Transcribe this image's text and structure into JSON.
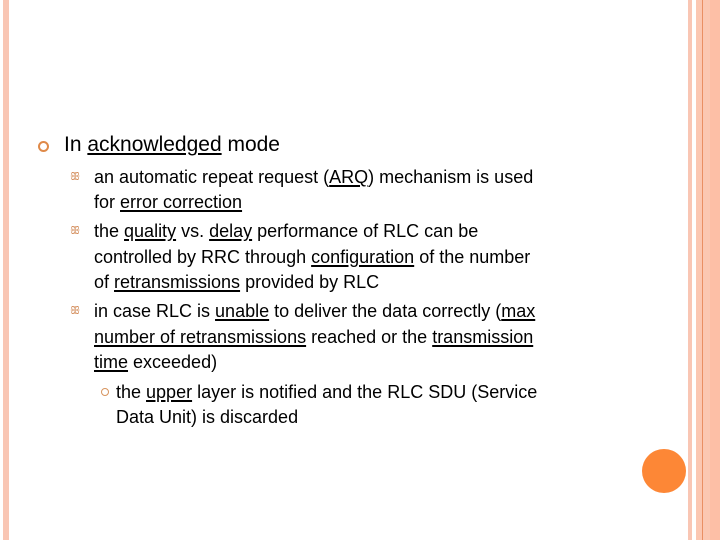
{
  "slide": {
    "level1": {
      "bullet_icon": "circle-bullet",
      "segments": [
        {
          "text": "In ",
          "u": false
        },
        {
          "text": "acknowledged",
          "u": true
        },
        {
          "text": " mode",
          "u": false
        }
      ]
    },
    "level2_bullet_icon": "swirl-bullet",
    "level3_bullet_icon": "small-circle-bullet",
    "lines": [
      {
        "segments": [
          {
            "text": "an automatic repeat request (",
            "u": false
          },
          {
            "text": "ARQ",
            "u": true
          },
          {
            "text": ") mechanism is used",
            "u": false
          }
        ]
      },
      {
        "segments": [
          {
            "text": "for ",
            "u": false
          },
          {
            "text": "error correction",
            "u": true
          }
        ]
      },
      {
        "segments": [
          {
            "text": "the ",
            "u": false
          },
          {
            "text": "quality",
            "u": true
          },
          {
            "text": " vs. ",
            "u": false
          },
          {
            "text": "delay",
            "u": true
          },
          {
            "text": " performance of RLC can be",
            "u": false
          }
        ]
      },
      {
        "segments": [
          {
            "text": "controlled by RRC through ",
            "u": false
          },
          {
            "text": "configuration",
            "u": true
          },
          {
            "text": " of the number",
            "u": false
          }
        ]
      },
      {
        "segments": [
          {
            "text": "of ",
            "u": false
          },
          {
            "text": "retransmissions",
            "u": true
          },
          {
            "text": " provided by RLC",
            "u": false
          }
        ]
      },
      {
        "segments": [
          {
            "text": "in case RLC is ",
            "u": false
          },
          {
            "text": "unable",
            "u": true
          },
          {
            "text": " to deliver the data correctly (",
            "u": false
          },
          {
            "text": "max",
            "u": true
          }
        ]
      },
      {
        "segments": [
          {
            "text": "number of retransmissions",
            "u": true
          },
          {
            "text": " reached or the ",
            "u": false
          },
          {
            "text": "transmission",
            "u": true
          }
        ]
      },
      {
        "segments": [
          {
            "text": "time",
            "u": true
          },
          {
            "text": " exceeded)",
            "u": false
          }
        ]
      },
      {
        "segments": [
          {
            "text": "the ",
            "u": false
          },
          {
            "text": "upper",
            "u": true
          },
          {
            "text": " layer is notified and the RLC SDU (Service",
            "u": false
          }
        ]
      },
      {
        "segments": [
          {
            "text": "Data Unit) is discarded",
            "u": false
          }
        ]
      }
    ]
  },
  "theme": {
    "accent_orange": "#fd8736",
    "stripe_color": "#f9c6b4"
  }
}
